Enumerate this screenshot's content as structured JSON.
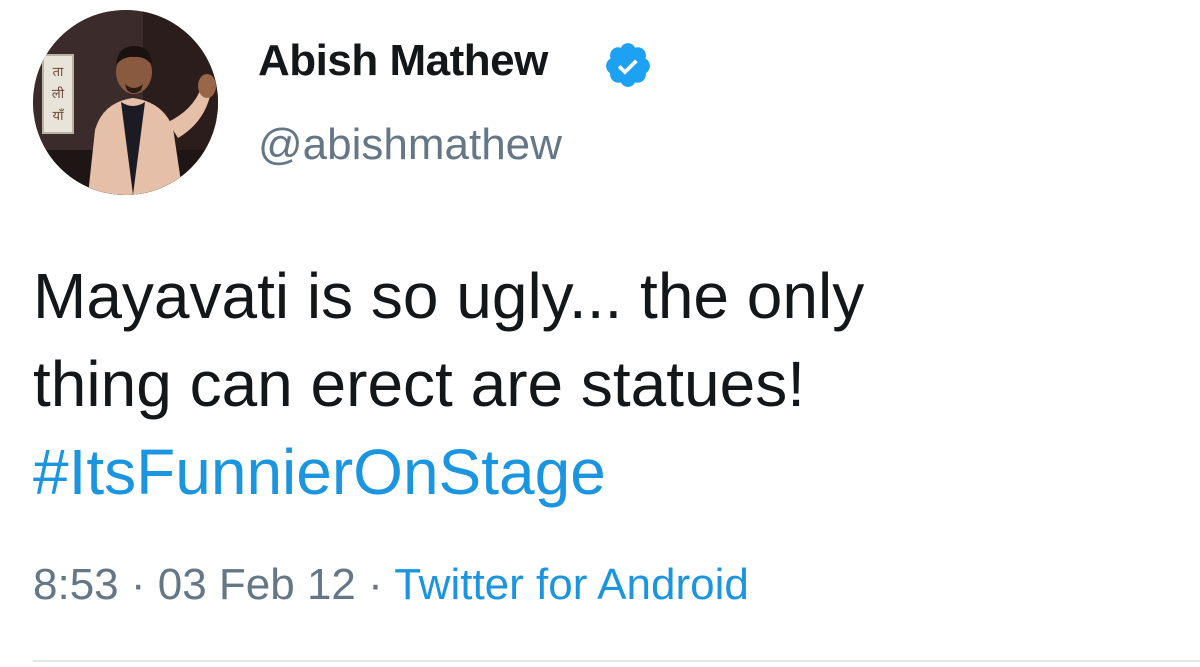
{
  "tweet": {
    "author": {
      "display_name": "Abish Mathew",
      "handle": "@abishmathew",
      "verified": true,
      "avatar_icon": "profile-photo",
      "avatar_sign_text": "ता ली याँ"
    },
    "text_lines": [
      "Mayavati is so ugly... the only",
      "thing can erect are statues!"
    ],
    "hashtag": "#ItsFunnierOnStage",
    "time": "8:53",
    "separator": " · ",
    "date": "03 Feb 12",
    "source": "Twitter for Android"
  },
  "colors": {
    "text": "#14171a",
    "secondary": "#657786",
    "link": "#1b95e0",
    "verified": "#1da1f2",
    "divider": "#e1e8ed"
  }
}
